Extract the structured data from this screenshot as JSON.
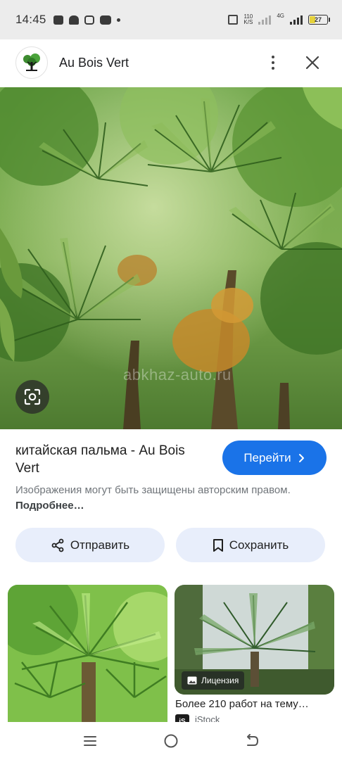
{
  "status_bar": {
    "time": "14:45",
    "net_speed_value": "110",
    "net_speed_unit": "K/S",
    "network_type": "4G",
    "battery": "27"
  },
  "header": {
    "site_name": "Au Bois Vert"
  },
  "hero": {
    "watermark": "abkhaz-auto.ru"
  },
  "result": {
    "title": "китайская пальма - Au Bois Vert",
    "go_label": "Перейти",
    "copyright_text": "Изображения могут быть защищены авторским правом.",
    "more_link": "Подробнее…",
    "share_label": "Отправить",
    "save_label": "Сохранить"
  },
  "related": {
    "item2_badge": "Лицензия",
    "item2_title": "Более 210 работ на тему…",
    "item2_source_logo": "iS",
    "item2_source": "iStock"
  },
  "colors": {
    "accent": "#1a73e8",
    "chip_bg": "#e8eefb",
    "status_bg": "#ececec"
  },
  "icons": {
    "lens": "google-lens-icon",
    "share": "share-icon",
    "save": "bookmark-icon",
    "close": "close-icon",
    "menu": "more-vert-icon"
  }
}
